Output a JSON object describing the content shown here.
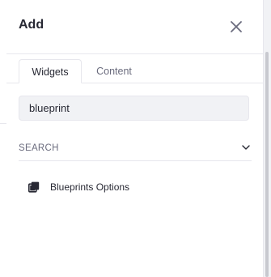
{
  "panel": {
    "title": "Add",
    "close_icon": "close-icon"
  },
  "tabs": [
    {
      "label": "Widgets",
      "active": true
    },
    {
      "label": "Content",
      "active": false
    }
  ],
  "search": {
    "value": "blueprint",
    "placeholder": ""
  },
  "section": {
    "title": "SEARCH",
    "expanded": true,
    "icon": "chevron-down-icon"
  },
  "results": [
    {
      "label": "Blueprints Options",
      "icon": "copy-icon"
    }
  ],
  "colors": {
    "text": "#272833",
    "muted": "#6b6c7e",
    "border": "#e7e7ed",
    "input_bg": "#f1f2f5"
  }
}
